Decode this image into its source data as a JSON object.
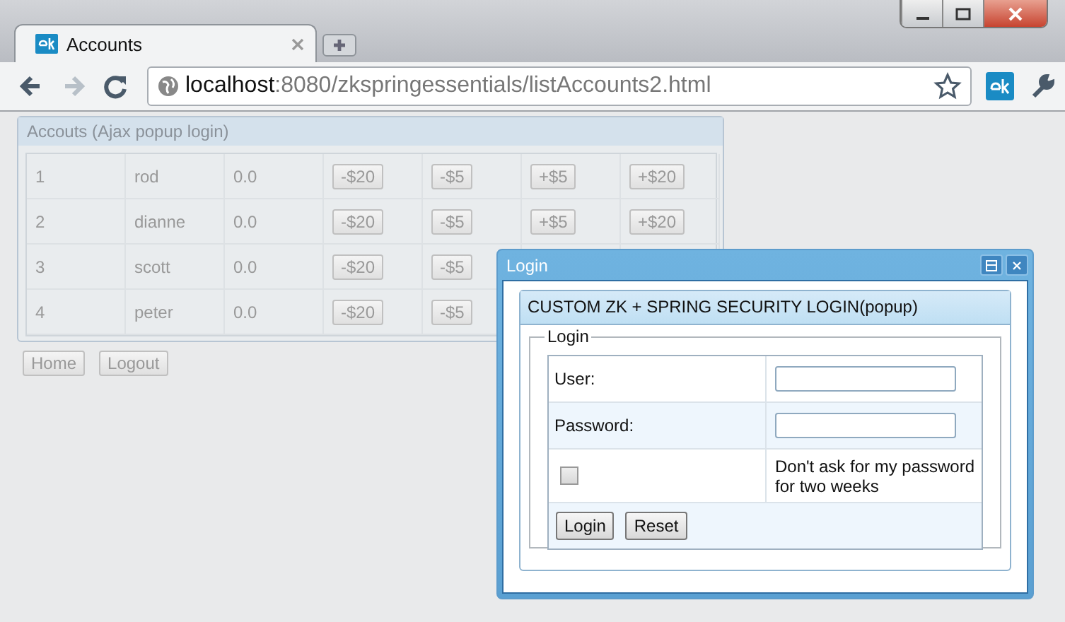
{
  "browser": {
    "tabs": [
      {
        "title": "Accounts",
        "selected": true
      }
    ],
    "address": {
      "host": "localhost",
      "path": ":8080/zkspringessentials/listAccounts2.html"
    }
  },
  "panel": {
    "title": "Accouts (Ajax popup login)",
    "rows": [
      {
        "cells": [
          "1",
          "rod",
          "0.0"
        ],
        "buttons": [
          "-$20",
          "-$5",
          "+$5",
          "+$20"
        ]
      },
      {
        "cells": [
          "2",
          "dianne",
          "0.0"
        ],
        "buttons": [
          "-$20",
          "-$5",
          "+$5",
          "+$20"
        ]
      },
      {
        "cells": [
          "3",
          "scott",
          "0.0"
        ],
        "buttons": [
          "-$20",
          "-$5"
        ]
      },
      {
        "cells": [
          "4",
          "peter",
          "0.0"
        ],
        "buttons": [
          "-$20",
          "-$5"
        ]
      }
    ],
    "actions": [
      "Home",
      "Logout"
    ]
  },
  "dialog": {
    "title": "Login",
    "heading": "CUSTOM ZK + SPRING SECURITY LOGIN(popup)",
    "group": "Login",
    "fields": [
      {
        "label": "User:"
      },
      {
        "label": "Password:"
      }
    ],
    "remember": {
      "label": "Don't ask for my password for two weeks",
      "checked": false
    },
    "buttons": [
      "Login",
      "Reset"
    ]
  }
}
